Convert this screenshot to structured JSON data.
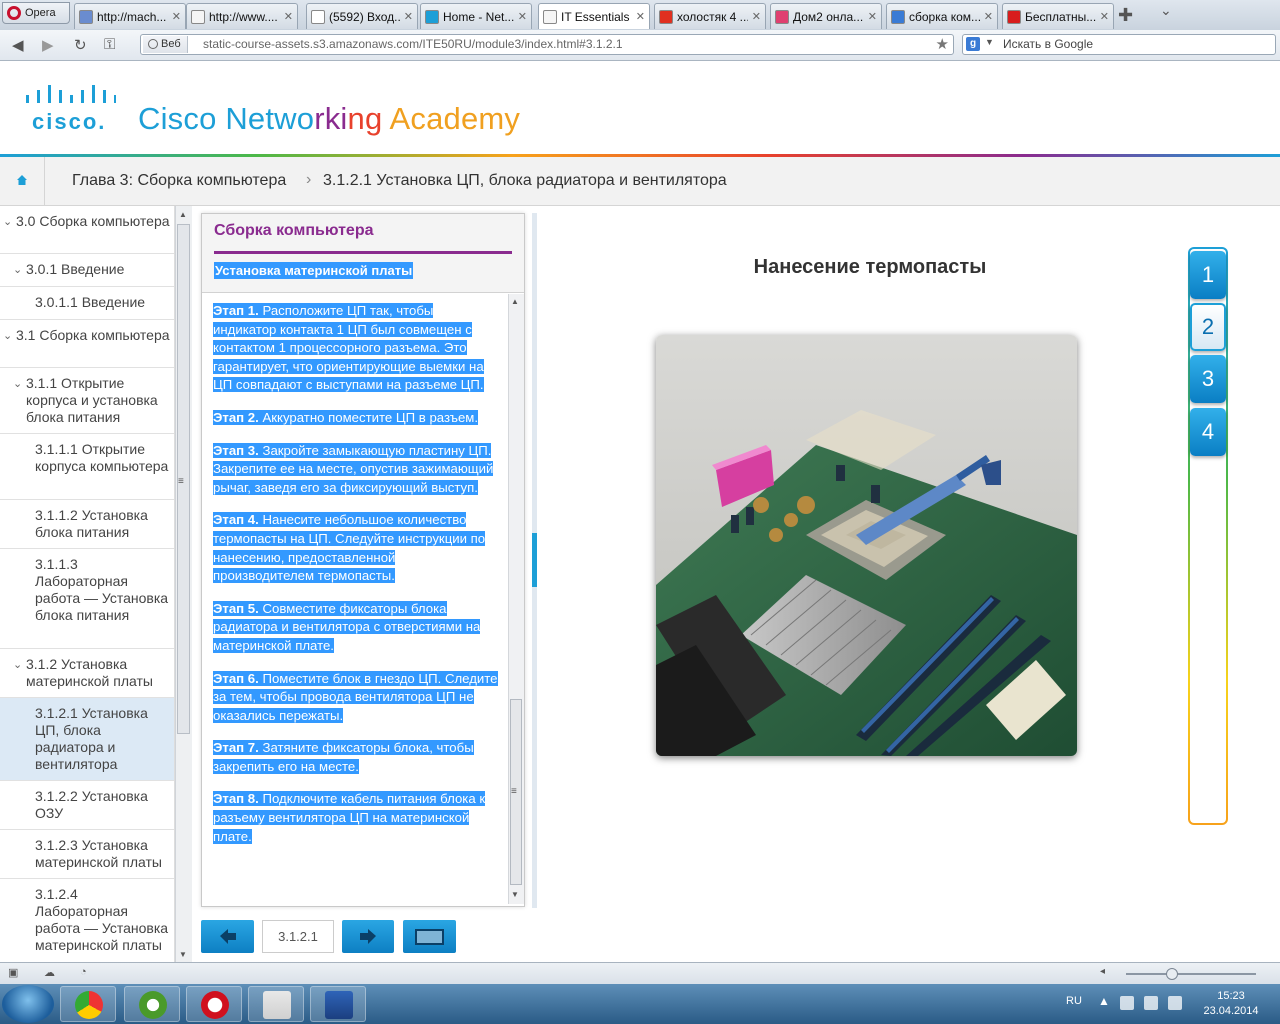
{
  "browser": {
    "menu_label": "Opera",
    "tabs": [
      {
        "label": "http://mach...",
        "icon": "globe-icon",
        "active": false
      },
      {
        "label": "http://www....",
        "icon": "page-icon",
        "active": false
      },
      {
        "label": "(5592) Вход...",
        "icon": "mail-icon",
        "active": false
      },
      {
        "label": "Home - Net...",
        "icon": "cisco-icon",
        "active": false
      },
      {
        "label": "IT Essentials",
        "icon": "page-icon",
        "active": true
      },
      {
        "label": "холостяк 4 ...",
        "icon": "yandex-icon",
        "active": false
      },
      {
        "label": "Дом2 онла...",
        "icon": "flower-icon",
        "active": false
      },
      {
        "label": "сборка ком...",
        "icon": "google-icon",
        "active": false
      },
      {
        "label": "Бесплатны...",
        "icon": "youtube-icon",
        "active": false
      }
    ],
    "address": {
      "badge": "Веб",
      "url": "static-course-assets.s3.amazonaws.com/ITE50RU/module3/index.html#3.1.2.1"
    },
    "search": {
      "engine": "g",
      "placeholder": "Искать в Google"
    }
  },
  "header": {
    "brand_word": "cisco.",
    "academy_parts": [
      {
        "text": "Cisco ",
        "color": "#1d9fd7"
      },
      {
        "text": "Netwo",
        "color": "#1d9fd7"
      },
      {
        "text": "rki",
        "color": "#8a2b8f"
      },
      {
        "text": "ng ",
        "color": "#e8412c"
      },
      {
        "text": "Academy",
        "color": "#f0a020"
      }
    ]
  },
  "breadcrumb": {
    "chapter": "Глава 3: Сборка компьютера",
    "separator": "›",
    "current": "3.1.2.1 Установка ЦП, блока радиатора и вентилятора"
  },
  "toc": [
    {
      "label": "3.0 Сборка компьютера",
      "level": 0,
      "selected": false
    },
    {
      "label": "3.0.1 Введение",
      "level": 1,
      "selected": false
    },
    {
      "label": "3.0.1.1 Введение",
      "level": 2,
      "selected": false
    },
    {
      "label": "3.1 Сборка компьютера",
      "level": 0,
      "selected": false
    },
    {
      "label": "3.1.1 Открытие корпуса и установка блока питания",
      "level": 1,
      "selected": false
    },
    {
      "label": "3.1.1.1 Открытие корпуса компьютера",
      "level": 2,
      "selected": false
    },
    {
      "label": "3.1.1.2 Установка блока питания",
      "level": 2,
      "selected": false
    },
    {
      "label": "3.1.1.3 Лабораторная работа — Установка блока питания",
      "level": 2,
      "selected": false
    },
    {
      "label": "3.1.2 Установка материнской платы",
      "level": 1,
      "selected": false
    },
    {
      "label": "3.1.2.1 Установка ЦП, блока радиатора и вентилятора",
      "level": 2,
      "selected": true
    },
    {
      "label": "3.1.2.2 Установка ОЗУ",
      "level": 2,
      "selected": false
    },
    {
      "label": "3.1.2.3 Установка материнской платы",
      "level": 2,
      "selected": false
    },
    {
      "label": "3.1.2.4 Лабораторная работа — Установка материнской платы",
      "level": 2,
      "selected": false
    }
  ],
  "panel": {
    "title": "Сборка компьютера",
    "subtitle": "Установка материнской платы",
    "steps": [
      {
        "label": "Этап 1.",
        "text": " Расположите ЦП так, чтобы индикатор контакта 1 ЦП был совмещен с контактом 1 процессорного разъема. Это гарантирует, что ориентирующие выемки на ЦП совпадают с выступами на разъеме ЦП."
      },
      {
        "label": "Этап 2.",
        "text": " Аккуратно поместите ЦП в разъем."
      },
      {
        "label": "Этап 3.",
        "text": " Закройте замыкающую пластину ЦП. Закрепите ее на месте, опустив зажимающий рычаг, заведя его за фиксирующий выступ."
      },
      {
        "label": "Этап 4.",
        "text": " Нанесите небольшое количество термопасты на ЦП. Следуйте инструкции по нанесению, предоставленной производителем термопасты."
      },
      {
        "label": "Этап 5.",
        "text": " Совместите фиксаторы блока радиатора и вентилятора с отверстиями на материнской плате."
      },
      {
        "label": "Этап 6.",
        "text": " Поместите блок в гнездо ЦП. Следите за тем, чтобы провода вентилятора ЦП не оказались пережаты."
      },
      {
        "label": "Этап 7.",
        "text": " Затяните фиксаторы блока, чтобы закрепить его на месте."
      },
      {
        "label": "Этап 8.",
        "text": " Подключите кабель питания блока к разъему вентилятора ЦП на материнской плате."
      }
    ]
  },
  "pager": {
    "page": "3.1.2.1"
  },
  "media": {
    "title": "Нанесение термопасты"
  },
  "step_tabs": [
    {
      "label": "1",
      "current": false
    },
    {
      "label": "2",
      "current": true
    },
    {
      "label": "3",
      "current": false
    },
    {
      "label": "4",
      "current": false
    }
  ],
  "taskbar": {
    "apps": [
      "chrome-icon",
      "utorrent-icon",
      "opera-icon",
      "acrobat-icon",
      "word-icon"
    ],
    "lang": "RU",
    "time": "15:23",
    "date": "23.04.2014"
  }
}
